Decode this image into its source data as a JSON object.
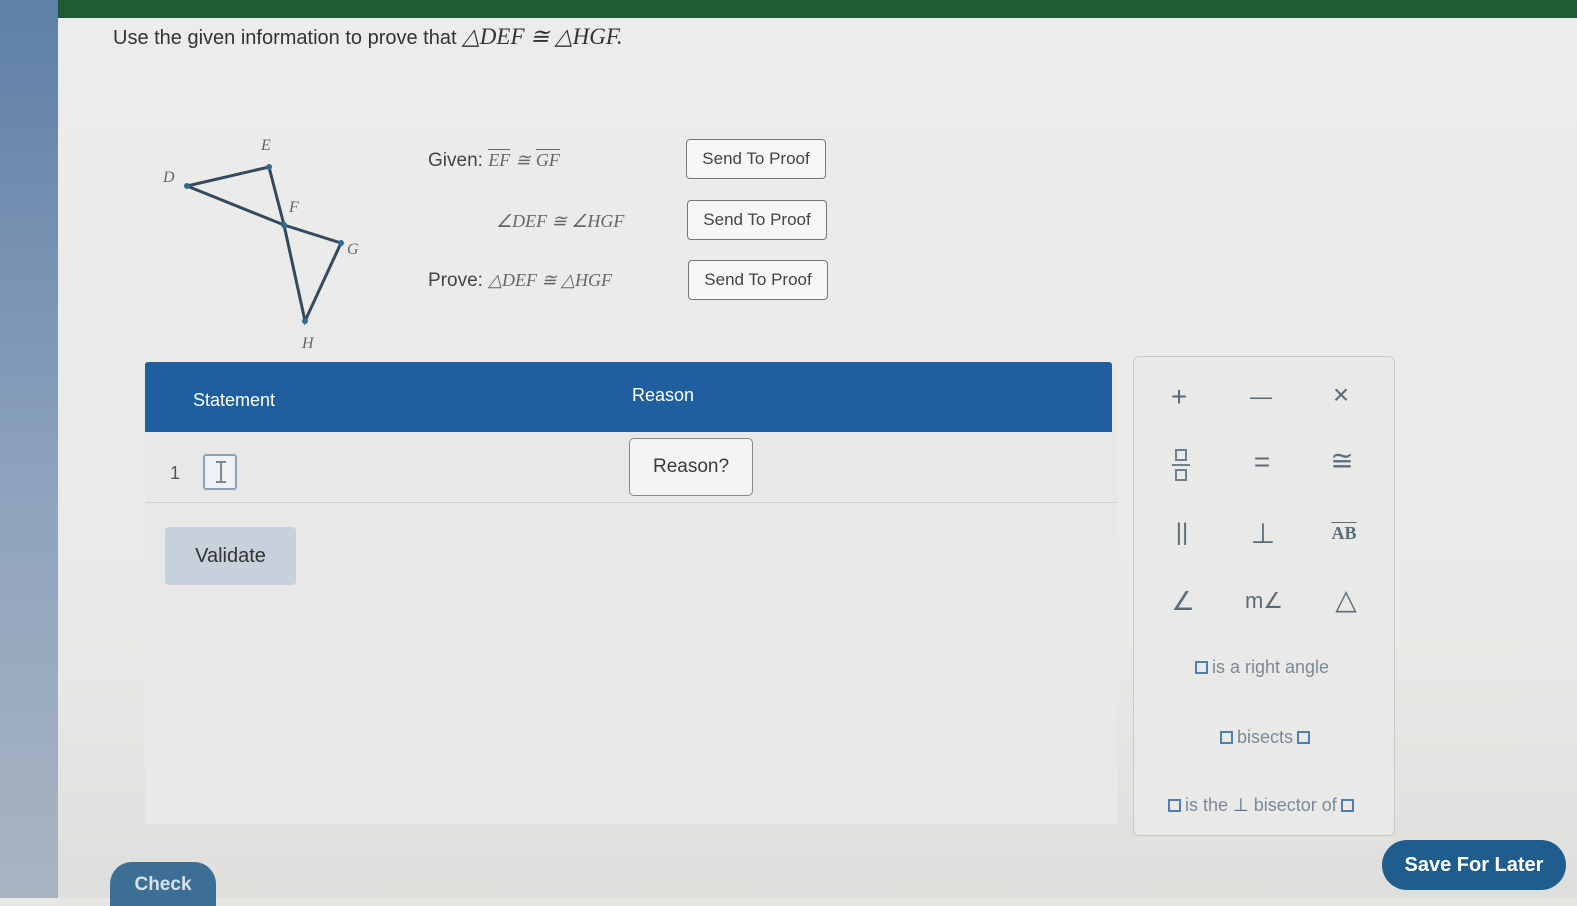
{
  "instruction": {
    "prefix": "Use the given information to prove that",
    "triangle_left": "△DEF",
    "congruent": "≅",
    "triangle_right": "△HGF."
  },
  "diagram": {
    "label_d": "D",
    "label_e": "E",
    "label_f": "F",
    "label_g": "G",
    "label_h": "H"
  },
  "givens": {
    "given_label": "Given:",
    "given1_seg1": "EF",
    "given1_symbol": "≅",
    "given1_seg2": "GF",
    "given2": "∠DEF ≅ ∠HGF",
    "prove_label": "Prove:",
    "prove_statement": "△DEF ≅ △HGF",
    "send_label": "Send To Proof"
  },
  "table": {
    "col_statement": "Statement",
    "col_reason": "Reason",
    "row_number": "1",
    "reason_button": "Reason?",
    "validate_button": "Validate"
  },
  "palette": {
    "plus": "+",
    "minus": "—",
    "times": "×",
    "equals": "=",
    "congruent": "≅",
    "parallel": "||",
    "perpendicular": "⊥",
    "segment": "AB",
    "angle": "∠",
    "measure_angle": "m∠",
    "triangle": "△",
    "right_angle_phrase": "is a right angle",
    "bisects_phrase": "bisects",
    "perp_bisector_is_the": "is the",
    "perp_bisector_symbol": "⊥",
    "perp_bisector_rest": "bisector of"
  },
  "footer": {
    "check_button": "Check",
    "save_button": "Save For Later"
  },
  "colors": {
    "header_blue": "#1f5fa0",
    "save_blue": "#1f5d8f",
    "top_bar_green": "#1e5a32"
  }
}
